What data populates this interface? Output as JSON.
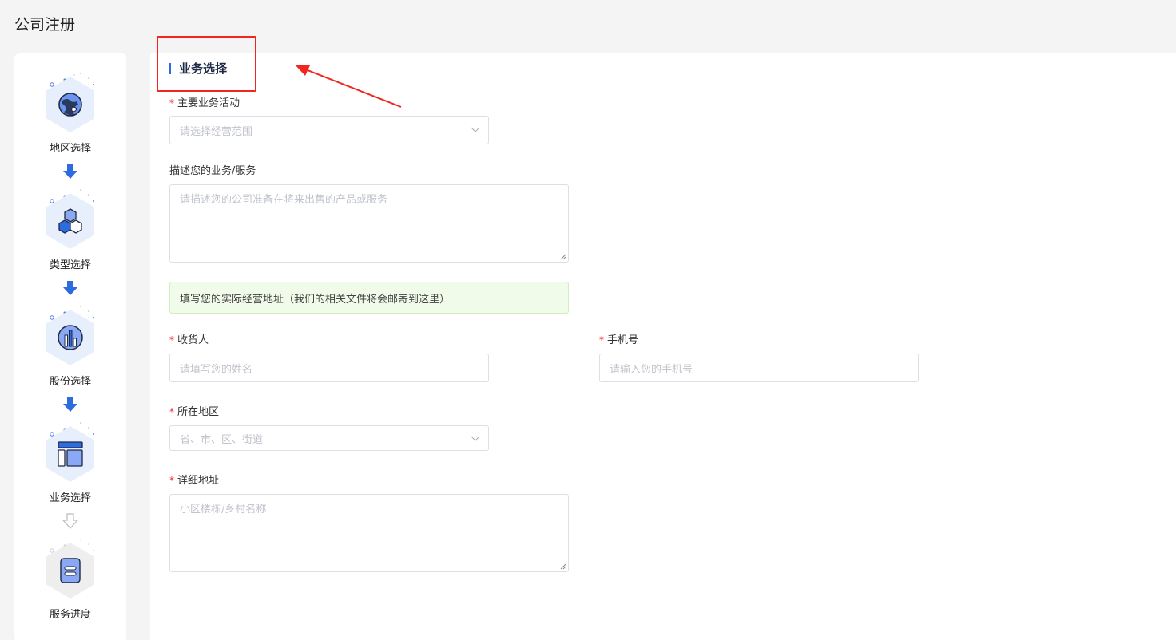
{
  "page": {
    "title": "公司注册"
  },
  "steps": [
    {
      "label": "地区选择",
      "icon": "globe-icon",
      "state": "done"
    },
    {
      "label": "类型选择",
      "icon": "hexagons-icon",
      "state": "done"
    },
    {
      "label": "股份选择",
      "icon": "bar-chart-icon",
      "state": "done"
    },
    {
      "label": "业务选择",
      "icon": "layout-icon",
      "state": "current"
    },
    {
      "label": "服务进度",
      "icon": "document-icon",
      "state": "pending"
    }
  ],
  "colors": {
    "accent": "#2c6be0",
    "required": "#f5222d",
    "annotation": "#f0261f",
    "notice_bg": "#f1fbe9"
  },
  "section": {
    "title": "业务选择"
  },
  "form": {
    "business_activity": {
      "label": "主要业务活动",
      "placeholder": "请选择经营范围",
      "required": true
    },
    "business_desc": {
      "label": "描述您的业务/服务",
      "placeholder": "请描述您的公司准备在将来出售的产品或服务"
    },
    "notice": "填写您的实际经营地址（我们的相关文件将会邮寄到这里）",
    "receiver": {
      "label": "收货人",
      "placeholder": "请填写您的姓名",
      "required": true
    },
    "phone": {
      "label": "手机号",
      "placeholder": "请输入您的手机号",
      "required": true
    },
    "region": {
      "label": "所在地区",
      "placeholder": "省、市、区、街道",
      "required": true
    },
    "address": {
      "label": "详细地址",
      "placeholder": "小区楼栋/乡村名称",
      "required": true
    }
  }
}
